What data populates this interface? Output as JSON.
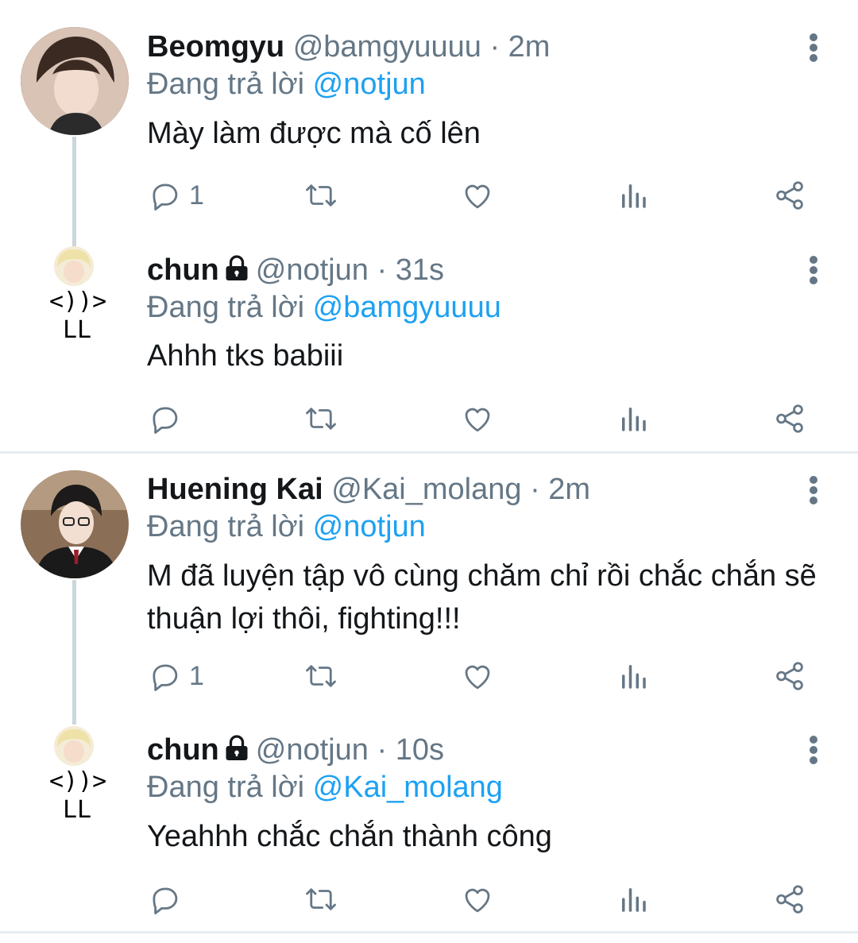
{
  "colors": {
    "accent": "#1da1f2",
    "muted": "#657786",
    "text": "#14171a",
    "divider": "#e6ecf0"
  },
  "icons": [
    "reply-icon",
    "retweet-icon",
    "like-icon",
    "analytics-icon",
    "share-icon",
    "more-vertical-icon",
    "lock-icon"
  ],
  "threads": [
    {
      "tweet": {
        "name": "Beomgyu",
        "handle": "@bamgyuuuu",
        "dot": "·",
        "time": "2m",
        "reply_prefix": "Đang trả lời",
        "reply_to": "@notjun",
        "text": "Mày làm được mà cố lên",
        "reply_count": "1"
      },
      "reply": {
        "name": "chun",
        "handle": "@notjun",
        "dot": "·",
        "time": "31s",
        "reply_prefix": "Đang trả lời",
        "reply_to": "@bamgyuuuu",
        "text": "Ahhh tks babiii",
        "ascii_avatar": "<))>\nLL"
      }
    },
    {
      "tweet": {
        "name": "Huening Kai",
        "handle": "@Kai_molang",
        "dot": "·",
        "time": "2m",
        "reply_prefix": "Đang trả lời",
        "reply_to": "@notjun",
        "text": "M đã luyện tập vô cùng chăm chỉ rồi chắc chắn sẽ thuận lợi thôi, fighting!!!",
        "reply_count": "1"
      },
      "reply": {
        "name": "chun",
        "handle": "@notjun",
        "dot": "·",
        "time": "10s",
        "reply_prefix": "Đang trả lời",
        "reply_to": "@Kai_molang",
        "text": "Yeahhh chắc chắn thành công",
        "ascii_avatar": "<))>\nLL"
      }
    }
  ]
}
